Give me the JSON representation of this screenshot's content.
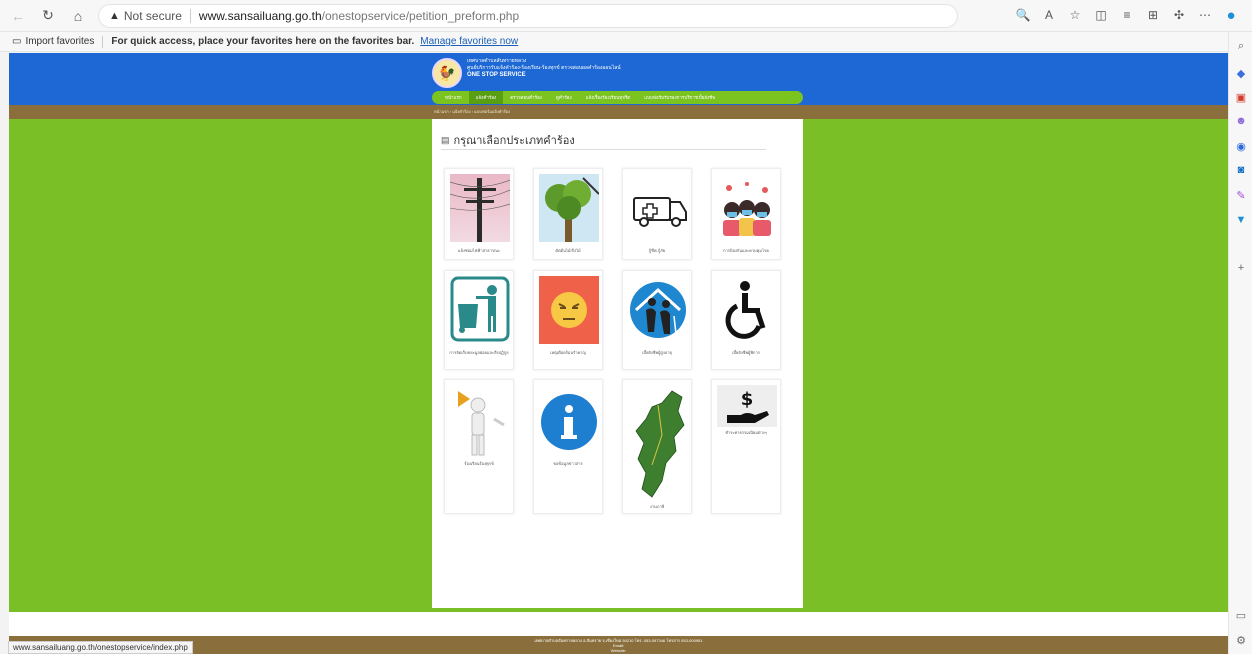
{
  "browser": {
    "not_secure": "Not secure",
    "url_host": "www.sansailuang.go.th",
    "url_path": "/onestopservice/petition_preform.php",
    "favorites": {
      "import": "Import favorites",
      "message": "For quick access, place your favorites here on the favorites bar.",
      "link": "Manage favorites now"
    },
    "status_url": "www.sansailuang.go.th/onestopservice/index.php"
  },
  "site": {
    "org_line1": "เทศบาลตำบลสันทรายหลวง",
    "org_line2": "ศูนย์บริการรับแจ้งคำร้อง-ร้องเรียน-ร้องทุกข์ ตรวจสอบผลคำร้องออนไลน์",
    "org_line3": "ONE STOP SERVICE",
    "menu": [
      "หน้าแรก",
      "แจ้งคำร้อง",
      "ตรวจสอบคำร้อง",
      "ดูคำร้อง",
      "แจ้งเรื่องร้องเรียนทุจริต",
      "แบบฟอร์มรับรองการบริการเบี้ยยังชีพ"
    ],
    "breadcrumb": "หน้าแรก › แจ้งคำร้อง › แบบฟอร์มแจ้งคำร้อง",
    "panel_title": "กรุณาเลือกประเภทคำร้อง",
    "cards": [
      {
        "label": "แจ้งซ่อมไฟฟ้าสาธารณะ",
        "icon": "electric-pole-icon"
      },
      {
        "label": "ตัดต้นไม้/กิ่งไม้",
        "icon": "tree-icon"
      },
      {
        "label": "กู้ชีพ-กู้ภัย",
        "icon": "ambulance-icon"
      },
      {
        "label": "การป้องกันและควบคุมโรค",
        "icon": "disease-control-icon"
      },
      {
        "label": "การจัดเก็บขยะมูลฝอยและสิ่งปฏิกูล",
        "icon": "garbage-icon"
      },
      {
        "label": "เหตุเดือดร้อนรำคาญ",
        "icon": "annoyed-face-icon"
      },
      {
        "label": "เบี้ยยังชีพผู้สูงอายุ",
        "icon": "elderly-icon"
      },
      {
        "label": "เบี้ยยังชีพผู้พิการ",
        "icon": "wheelchair-icon"
      },
      {
        "label": "ร้องเรียนร้องทุกข์",
        "icon": "megaphone-icon"
      },
      {
        "label": "ขอข้อมูลข่าวสาร",
        "icon": "info-icon"
      },
      {
        "label": "งานภาษี",
        "icon": "map-icon"
      },
      {
        "label": "ชำระค่าธรรมเนียมต่างๆ",
        "icon": "payment-icon"
      }
    ],
    "footer_line1": "เทศบาลตำบลสันทรายหลวง อ.สันทราย จ.เชียงใหม่ 50210 โทร. 053-097346 โทรสาร 053-000951",
    "footer_line2": "Email:",
    "footer_line3": "Website:"
  },
  "colors": {
    "header_blue": "#1d68d4",
    "page_green": "#7bbf26",
    "menu_green": "#7bc31e",
    "breadcrumb_brown": "#8a6f3c"
  }
}
